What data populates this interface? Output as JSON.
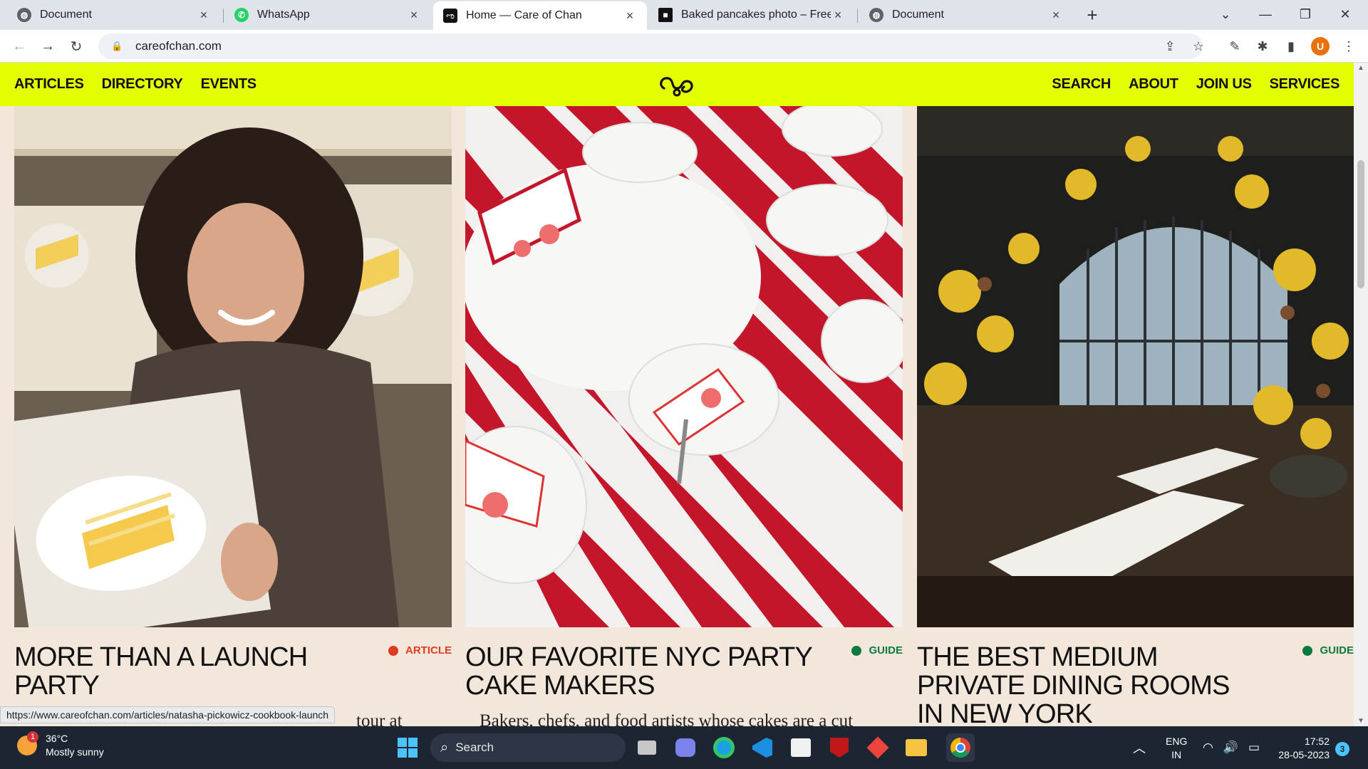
{
  "browser": {
    "tabs": [
      {
        "title": "Document",
        "icon": "globe-icon",
        "active": false
      },
      {
        "title": "WhatsApp",
        "icon": "whatsapp-icon",
        "active": false
      },
      {
        "title": "Home — Care of Chan",
        "icon": "careofchan-favicon",
        "active": true
      },
      {
        "title": "Baked pancakes photo – Free Fo",
        "icon": "unsplash-icon",
        "active": false
      },
      {
        "title": "Document",
        "icon": "globe-icon",
        "active": false
      }
    ],
    "url": "careofchan.com",
    "profile_initial": "U",
    "status_url": "https://www.careofchan.com/articles/natasha-pickowicz-cookbook-launch"
  },
  "site": {
    "nav_left": [
      "ARTICLES",
      "DIRECTORY",
      "EVENTS"
    ],
    "nav_right": [
      "SEARCH",
      "ABOUT",
      "JOIN US",
      "SERVICES"
    ],
    "logo": "care-of-chan-logo",
    "accent_color": "#e3ff00"
  },
  "cards": [
    {
      "title": "MORE THAN A LAUNCH PARTY",
      "tag": "ARTICLE",
      "tag_color": "#e03a1e",
      "excerpt": "tour at",
      "image": "woman-holding-cookbook-photo"
    },
    {
      "title": "OUR FAVORITE NYC PARTY CAKE MAKERS",
      "tag": "GUIDE",
      "tag_color": "#0b7a3e",
      "excerpt": "Bakers, chefs, and food artists whose cakes are a cut",
      "image": "strawberry-cake-slices-photo"
    },
    {
      "title": "THE BEST MEDIUM PRIVATE DINING ROOMS IN NEW YORK",
      "tag": "GUIDE",
      "tag_color": "#0b7a3e",
      "excerpt": "",
      "image": "restaurant-dining-room-photo"
    }
  ],
  "taskbar": {
    "weather_temp": "36°C",
    "weather_desc": "Mostly sunny",
    "weather_badge": "1",
    "search_label": "Search",
    "lang": "ENG",
    "region": "IN",
    "time": "17:52",
    "date": "28-05-2023",
    "notifications": "3"
  }
}
